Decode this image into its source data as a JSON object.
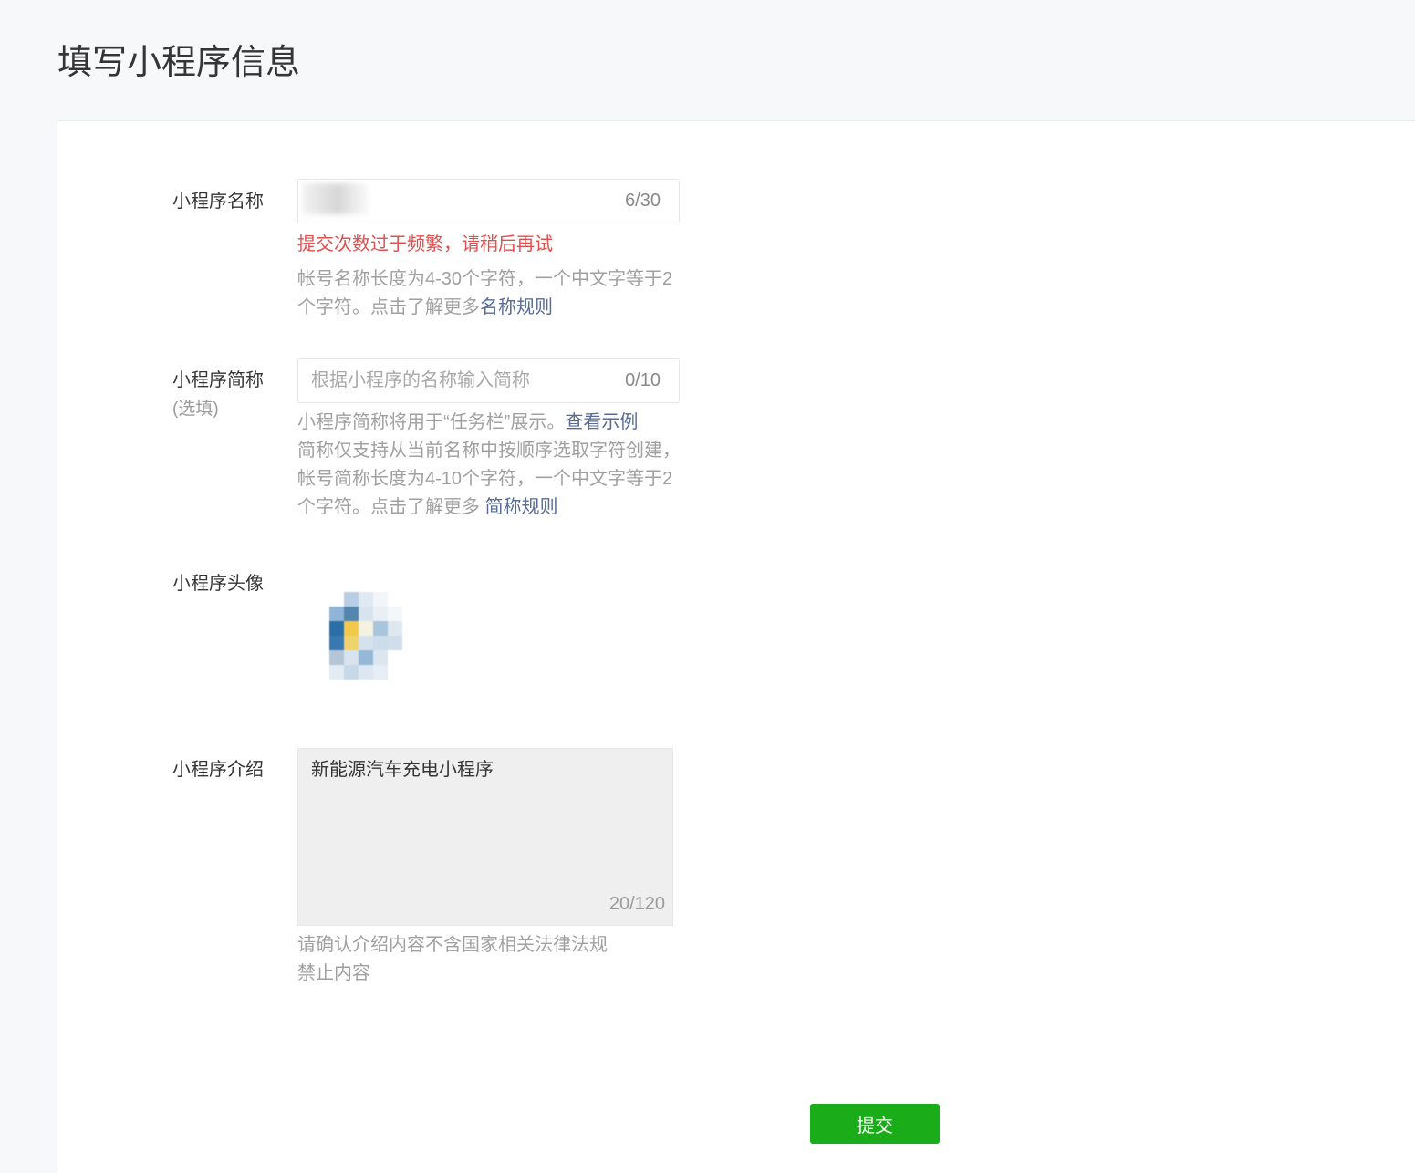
{
  "page": {
    "title": "填写小程序信息"
  },
  "form": {
    "name": {
      "label": "小程序名称",
      "counter": "6/30",
      "error": "提交次数过于频繁，请稍后再试",
      "hint": "帐号名称长度为4-30个字符，一个中文字等于2个字符。点击了解更多",
      "hint_link": "名称规则"
    },
    "short_name": {
      "label": "小程序简称",
      "optional": "(选填)",
      "placeholder": "根据小程序的名称输入简称",
      "counter": "0/10",
      "hint_1": "小程序简称将用于“任务栏”展示。",
      "hint_1_link": "查看示例",
      "hint_2": "简称仅支持从当前名称中按顺序选取字符创建，帐号简称长度为4-10个字符，一个中文字等于2个字符。点击了解更多 ",
      "hint_2_link": "简称规则"
    },
    "avatar": {
      "label": "小程序头像"
    },
    "intro": {
      "label": "小程序介绍",
      "value": "新能源汽车充电小程序",
      "counter": "20/120",
      "hint": "请确认介绍内容不含国家相关法律法规禁止内容"
    },
    "submit_label": "提交"
  },
  "colors": {
    "accent_green": "#1aad19",
    "error_red": "#e04f4f",
    "link_blue": "#576b95"
  }
}
